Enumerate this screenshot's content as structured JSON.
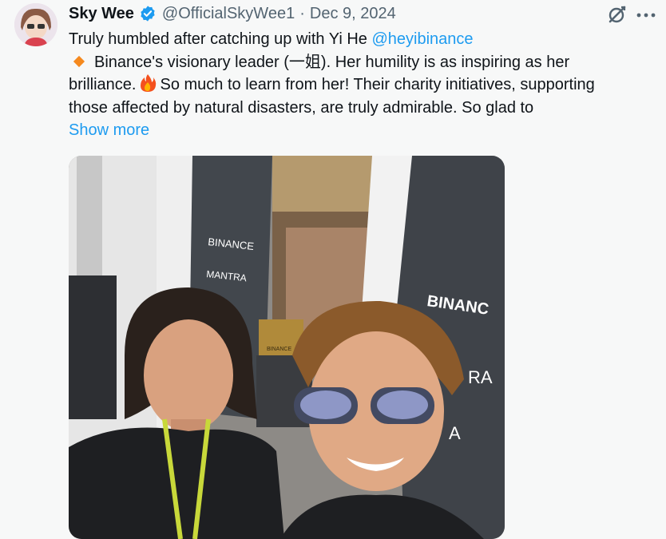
{
  "tweet": {
    "author_name": "Sky Wee",
    "handle": "@OfficialSkyWee1",
    "separator": "·",
    "date": "Dec 9, 2024",
    "text_line1_prefix": "Truly humbled after catching up with Yi He ",
    "mention": "@heyibinance",
    "text_line2a": "Binance's visionary leader (一姐). Her humility is as inspiring as her",
    "text_line3a": "brilliance.",
    "text_line3b": "So much to learn from her! Their charity initiatives, supporting",
    "text_line4": "those affected by natural disasters, are truly admirable. So glad to",
    "show_more": "Show more"
  },
  "photo": {
    "signs": [
      "BINANCE",
      "MANTRA",
      "BINANCE",
      "BINANC",
      "RA",
      "A"
    ]
  },
  "colors": {
    "accent": "#1d9bf0",
    "muted": "#536471",
    "diamond": "#f5891e"
  },
  "icons": [
    "verified-badge-icon",
    "grok-icon",
    "more-icon",
    "orange-diamond-icon",
    "fire-emoji-icon"
  ]
}
